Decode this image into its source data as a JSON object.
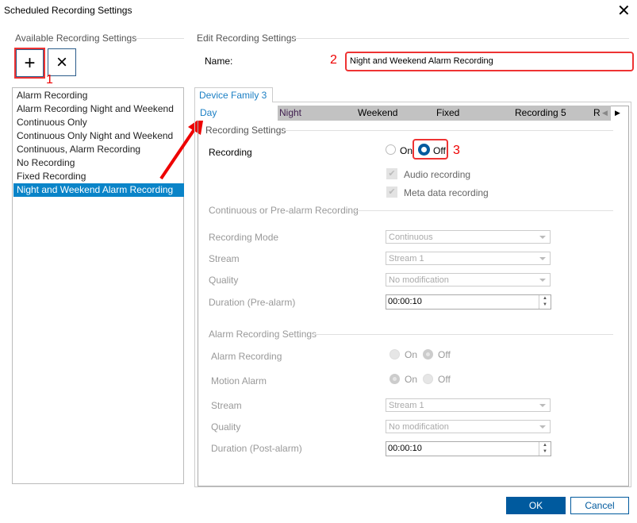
{
  "window": {
    "title": "Scheduled Recording Settings",
    "close_icon": "close-icon"
  },
  "left": {
    "header": "Available Recording Settings",
    "add_label": "+",
    "delete_label": "×",
    "annotation": "1",
    "items": [
      "Alarm Recording",
      "Alarm Recording Night and Weekend",
      "Continuous Only",
      "Continuous Only Night and Weekend",
      "Continuous, Alarm Recording",
      "No Recording",
      "Fixed Recording",
      "Night and Weekend Alarm Recording"
    ],
    "selected": "Night and Weekend Alarm Recording"
  },
  "right": {
    "header": "Edit Recording Settings",
    "name_label": "Name:",
    "name_annotation": "2",
    "name_value": "Night and Weekend Alarm Recording",
    "device_tab": "Device Family 3",
    "subtabs": [
      "Day",
      "Night",
      "Weekend",
      "Fixed",
      "Recording 5",
      "R"
    ],
    "recording_settings": {
      "header": "Recording Settings",
      "recording_label": "Recording",
      "on": "On",
      "off": "Off",
      "selected": "Off",
      "annotation": "3",
      "audio": "Audio recording",
      "meta": "Meta data recording"
    },
    "continuous": {
      "header": "Continuous or Pre-alarm Recording",
      "mode_label": "Recording Mode",
      "mode": "Continuous",
      "stream_label": "Stream",
      "stream": "Stream 1",
      "quality_label": "Quality",
      "quality": "No modification",
      "duration_label": "Duration (Pre-alarm)",
      "duration": "00:00:10"
    },
    "alarm": {
      "header": "Alarm Recording Settings",
      "alarm_label": "Alarm Recording",
      "alarm_on": "On",
      "alarm_off": "Off",
      "alarm_selected": "Off",
      "motion_label": "Motion Alarm",
      "motion_on": "On",
      "motion_off": "Off",
      "motion_selected": "On",
      "stream_label": "Stream",
      "stream": "Stream 1",
      "quality_label": "Quality",
      "quality": "No modification",
      "duration_label": "Duration (Post-alarm)",
      "duration": "00:00:10"
    }
  },
  "footer": {
    "ok": "OK",
    "cancel": "Cancel"
  },
  "colors": {
    "accent": "#005a9e",
    "selection": "#0a84c8",
    "highlight": "#e00000"
  }
}
